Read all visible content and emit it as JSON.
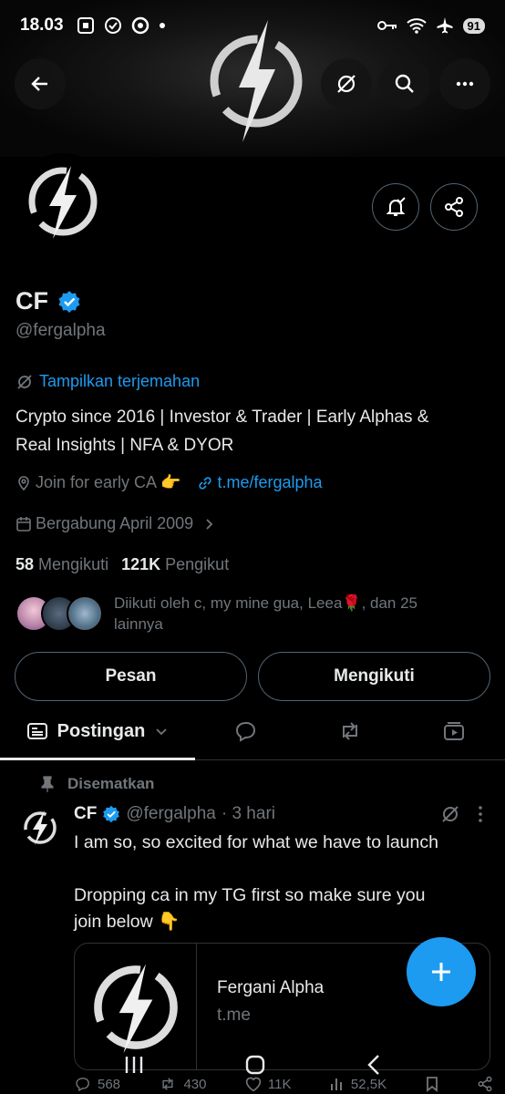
{
  "status_bar": {
    "time": "18.03",
    "battery": "91",
    "icons": [
      "screenshot-icon",
      "check-badge-icon",
      "app-icon",
      "dot-icon",
      "key-icon",
      "wifi-icon",
      "airplane-icon"
    ]
  },
  "top_bar": {
    "back_icon": "arrow-left-icon",
    "translate_icon": "translate-icon",
    "search_icon": "search-icon",
    "more_icon": "more-horizontal-icon"
  },
  "profile": {
    "name": "CF",
    "verified": true,
    "handle": "@fergalpha",
    "translate_label": "Tampilkan terjemahan",
    "bio_line1": "Crypto since 2016 | Investor & Trader | Early Alphas &",
    "bio_line2": "Real Insights | NFA & DYOR",
    "location": "Join for early CA 👉",
    "website": "t.me/fergalpha",
    "joined": "Bergabung April 2009",
    "following_count": "58",
    "following_label": "Mengikuti",
    "followers_count": "121K",
    "followers_label": "Pengikut",
    "followed_by_line1": "Diikuti oleh c, my mine gua, Leea🌹, dan 25",
    "followed_by_line2": "lainnya",
    "message_button": "Pesan",
    "following_button": "Mengikuti"
  },
  "tabs": {
    "posts_label": "Postingan",
    "replies_icon": "reply-icon",
    "reposts_icon": "repost-icon",
    "media_icon": "media-icon"
  },
  "post": {
    "pinned_label": "Disematkan",
    "author_name": "CF",
    "author_handle": "@fergalpha",
    "time": "· 3 hari",
    "text_line1": "I am so, so excited for what we have to launch",
    "text_line2": "Dropping ca in my TG first so make sure you",
    "text_line3": "join below 👇",
    "card_title": "Fergani Alpha",
    "card_domain": "t.me",
    "reply_count": "568",
    "repost_count": "430",
    "like_count": "11K",
    "view_count": "52,5K"
  },
  "colors": {
    "accent": "#1d9bf0",
    "background": "#000000",
    "text": "#e7e9ea",
    "muted": "#71767b",
    "border": "#2f3336"
  }
}
